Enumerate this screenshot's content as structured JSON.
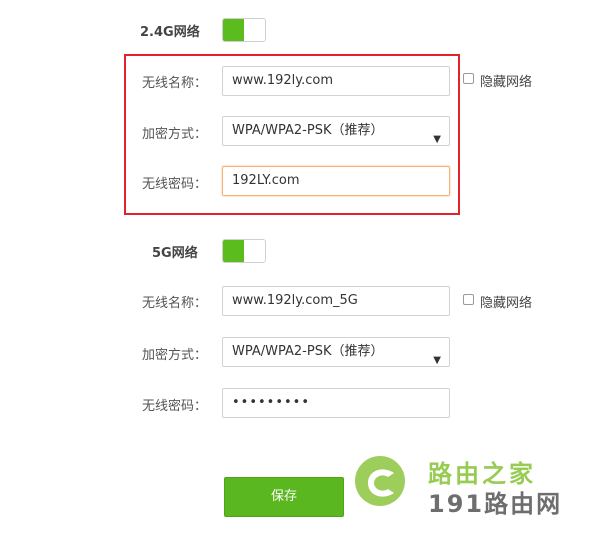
{
  "band_24": {
    "title": "2.4G网络",
    "enabled": true,
    "ssid_label": "无线名称：",
    "ssid_value": "www.192ly.com",
    "hide_label": "隐藏网络",
    "enc_label": "加密方式：",
    "enc_value": "WPA/WPA2-PSK（推荐）",
    "pwd_label": "无线密码：",
    "pwd_value": "192LY.com"
  },
  "band_5": {
    "title": "5G网络",
    "enabled": true,
    "ssid_label": "无线名称：",
    "ssid_value": "www.192ly.com_5G",
    "hide_label": "隐藏网络",
    "enc_label": "加密方式：",
    "enc_value": "WPA/WPA2-PSK（推荐）",
    "pwd_label": "无线密码：",
    "pwd_value": "•••••••••"
  },
  "actions": {
    "save_label": "保存"
  },
  "watermark": {
    "line1": "路由之家",
    "line2": "191路由网"
  },
  "colors": {
    "accent": "#5bbd1d",
    "highlight": "#e2232a",
    "focus": "#f4b27a"
  }
}
